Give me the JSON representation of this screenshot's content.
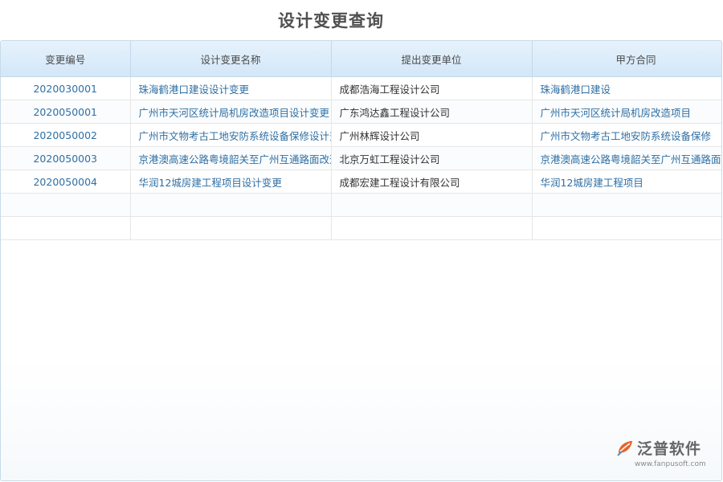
{
  "page": {
    "title": "设计变更查询"
  },
  "table": {
    "headers": [
      "变更编号",
      "设计变更名称",
      "提出变更单位",
      "甲方合同"
    ],
    "rows": [
      [
        "2020030001",
        "珠海鹤港口建设设计变更",
        "成都浩海工程设计公司",
        "珠海鹤港口建设"
      ],
      [
        "2020050001",
        "广州市天河区统计局机房改造项目设计变更",
        "广东鸿达鑫工程设计公司",
        "广州市天河区统计局机房改造项目"
      ],
      [
        "2020050002",
        "广州市文物考古工地安防系统设备保修设计变更",
        "广州林辉设计公司",
        "广州市文物考古工地安防系统设备保修"
      ],
      [
        "2020050003",
        "京港澳高速公路粤境韶关至广州互通路面改造设计变更",
        "北京万虹工程设计公司",
        "京港澳高速公路粤境韶关至广州互通路面改造"
      ],
      [
        "2020050004",
        "华润12城房建工程项目设计变更",
        "成都宏建工程设计有限公司",
        "华润12城房建工程项目"
      ]
    ],
    "empty_rows": 2
  },
  "logo": {
    "text": "泛普软件",
    "url": "www.fanpusoft.com",
    "icon": "fanpu-logo-icon",
    "accent": "#e8632b"
  }
}
